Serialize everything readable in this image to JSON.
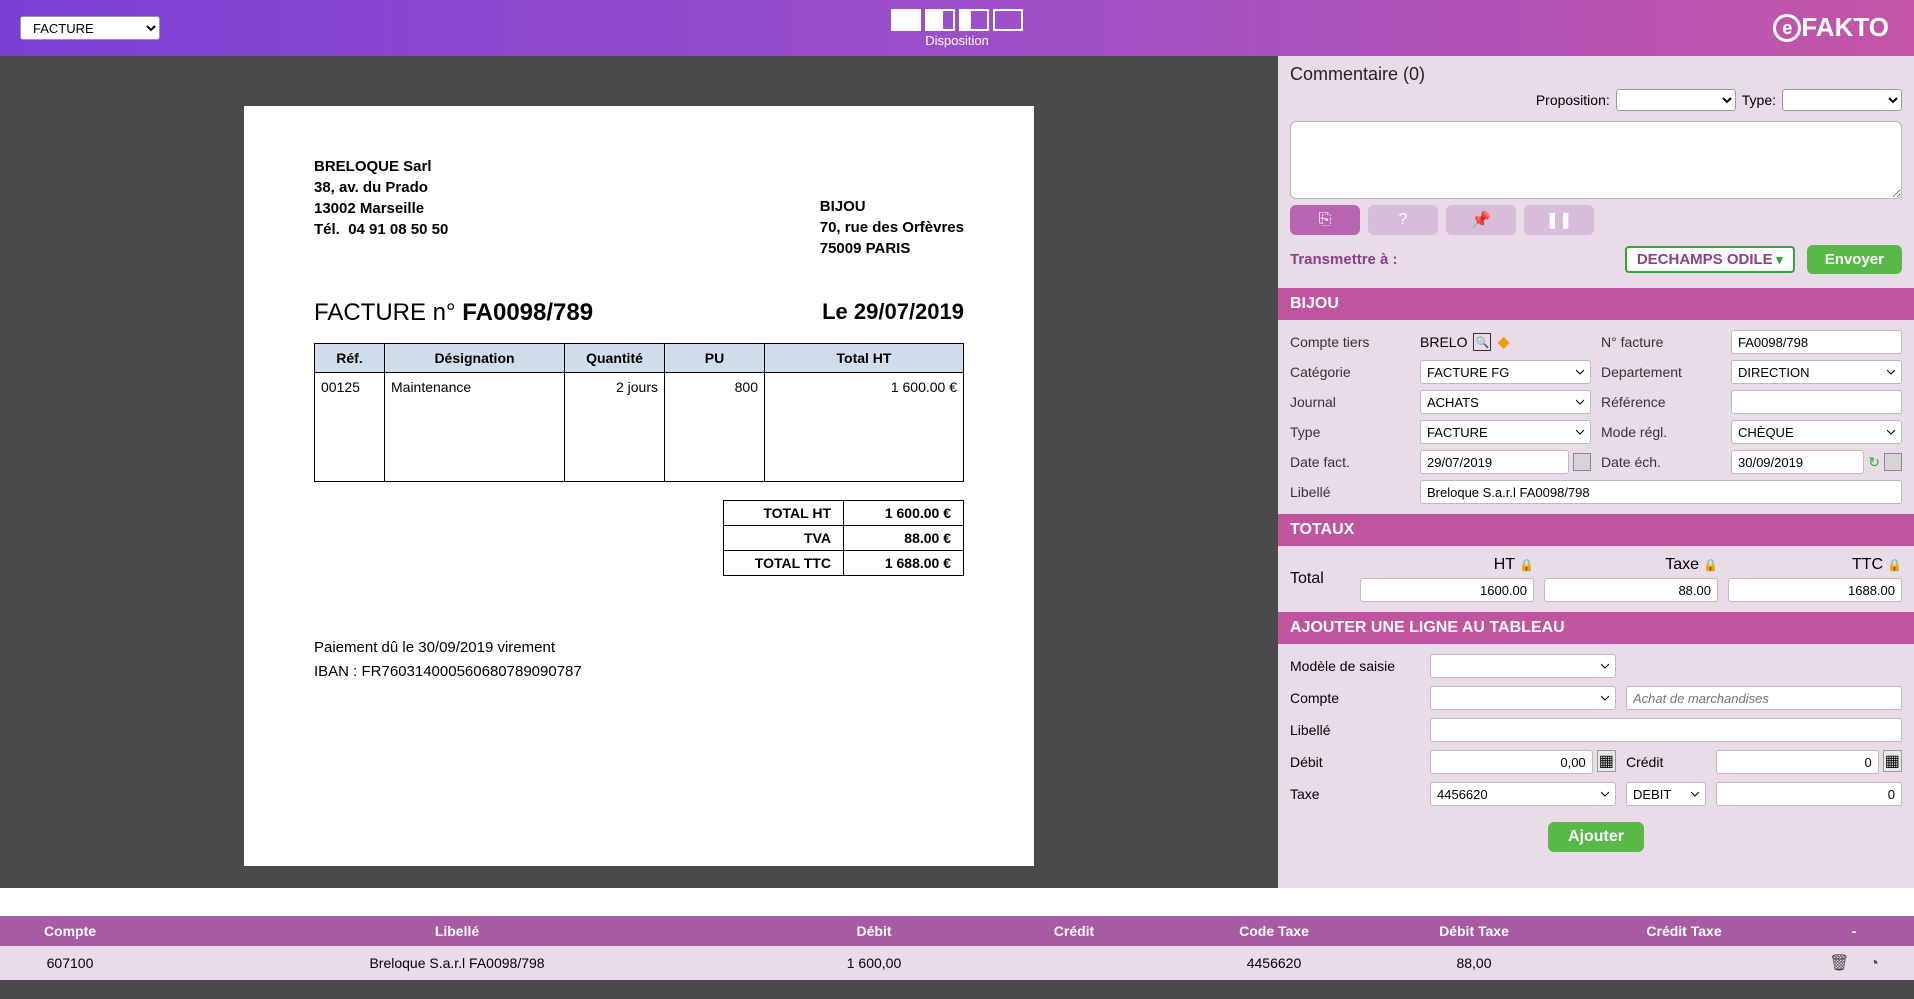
{
  "header": {
    "type_selector": "FACTURE",
    "disposition_label": "Disposition",
    "logo_text": "FAKTO"
  },
  "document": {
    "from": {
      "name": "BRELOQUE Sarl",
      "street": "38, av. du Prado",
      "city": "13002 Marseille",
      "tel_label": "Tél.",
      "tel": "04 91 08 50 50"
    },
    "to": {
      "name": "BIJOU",
      "street": "70, rue des Orfèvres",
      "city": "75009 PARIS"
    },
    "title_prefix": "FACTURE n°",
    "title_number": "FA0098/789",
    "date_prefix": "Le",
    "date": "29/07/2019",
    "columns": {
      "ref": "Réf.",
      "desig": "Désignation",
      "qte": "Quantité",
      "pu": "PU",
      "total": "Total HT"
    },
    "line": {
      "ref": "00125",
      "desig": "Maintenance",
      "qte": "2 jours",
      "pu": "800",
      "total": "1 600.00 €"
    },
    "totals": {
      "ht_label": "TOTAL HT",
      "ht": "1 600.00 €",
      "tva_label": "TVA",
      "tva": "88.00 €",
      "ttc_label": "TOTAL TTC",
      "ttc": "1 688.00 €"
    },
    "payment": "Paiement dû le 30/09/2019 virement",
    "iban": "IBAN : FR760314000560680789090787"
  },
  "right": {
    "comment_header": "Commentaire (0)",
    "proposition_label": "Proposition:",
    "type_label": "Type:",
    "transmit_label": "Transmettre à :",
    "transmit_dest": "DECHAMPS ODILE",
    "send": "Envoyer",
    "section_bijou": "BIJOU",
    "fields": {
      "compte_tiers": "Compte tiers",
      "compte_tiers_val": "BRELO",
      "num_facture": "N° facture",
      "num_facture_val": "FA0098/798",
      "categorie": "Catégorie",
      "categorie_val": "FACTURE FG",
      "departement": "Departement",
      "departement_val": "DIRECTION",
      "journal": "Journal",
      "journal_val": "ACHATS",
      "reference": "Référence",
      "reference_val": "",
      "type": "Type",
      "type_val": "FACTURE",
      "mode_regl": "Mode régl.",
      "mode_regl_val": "CHÈQUE",
      "date_fact": "Date fact.",
      "date_fact_val": "29/07/2019",
      "date_ech": "Date éch.",
      "date_ech_val": "30/09/2019",
      "libelle": "Libellé",
      "libelle_val": "Breloque S.a.r.l FA0098/798"
    },
    "totaux": {
      "label": "TOTAUX",
      "ht": "HT",
      "ht_val": "1600.00",
      "taxe": "Taxe",
      "taxe_val": "88.00",
      "ttc": "TTC",
      "ttc_val": "1688.00",
      "total": "Total"
    },
    "add": {
      "label": "AJOUTER UNE LIGNE AU TABLEAU",
      "modele": "Modèle de saisie",
      "modele_val": "",
      "compte": "Compte",
      "compte_val": "",
      "compte_ph": "Achat de marchandises",
      "libelle": "Libellé",
      "libelle_val": "",
      "debit": "Débit",
      "debit_val": "0,00",
      "credit": "Crédit",
      "credit_val": "0",
      "taxe": "Taxe",
      "taxe_val": "4456620",
      "dc": "DEBIT",
      "dc_amount": "0",
      "ajouter": "Ajouter"
    }
  },
  "bottom": {
    "headers": {
      "compte": "Compte",
      "libelle": "Libellé",
      "debit": "Débit",
      "credit": "Crédit",
      "code_taxe": "Code Taxe",
      "debit_taxe": "Débit Taxe",
      "credit_taxe": "Crédit Taxe",
      "dash": "-"
    },
    "row": {
      "compte": "607100",
      "libelle": "Breloque S.a.r.l FA0098/798",
      "debit": "1 600,00",
      "credit": "",
      "code_taxe": "4456620",
      "debit_taxe": "88,00",
      "credit_taxe": ""
    }
  }
}
